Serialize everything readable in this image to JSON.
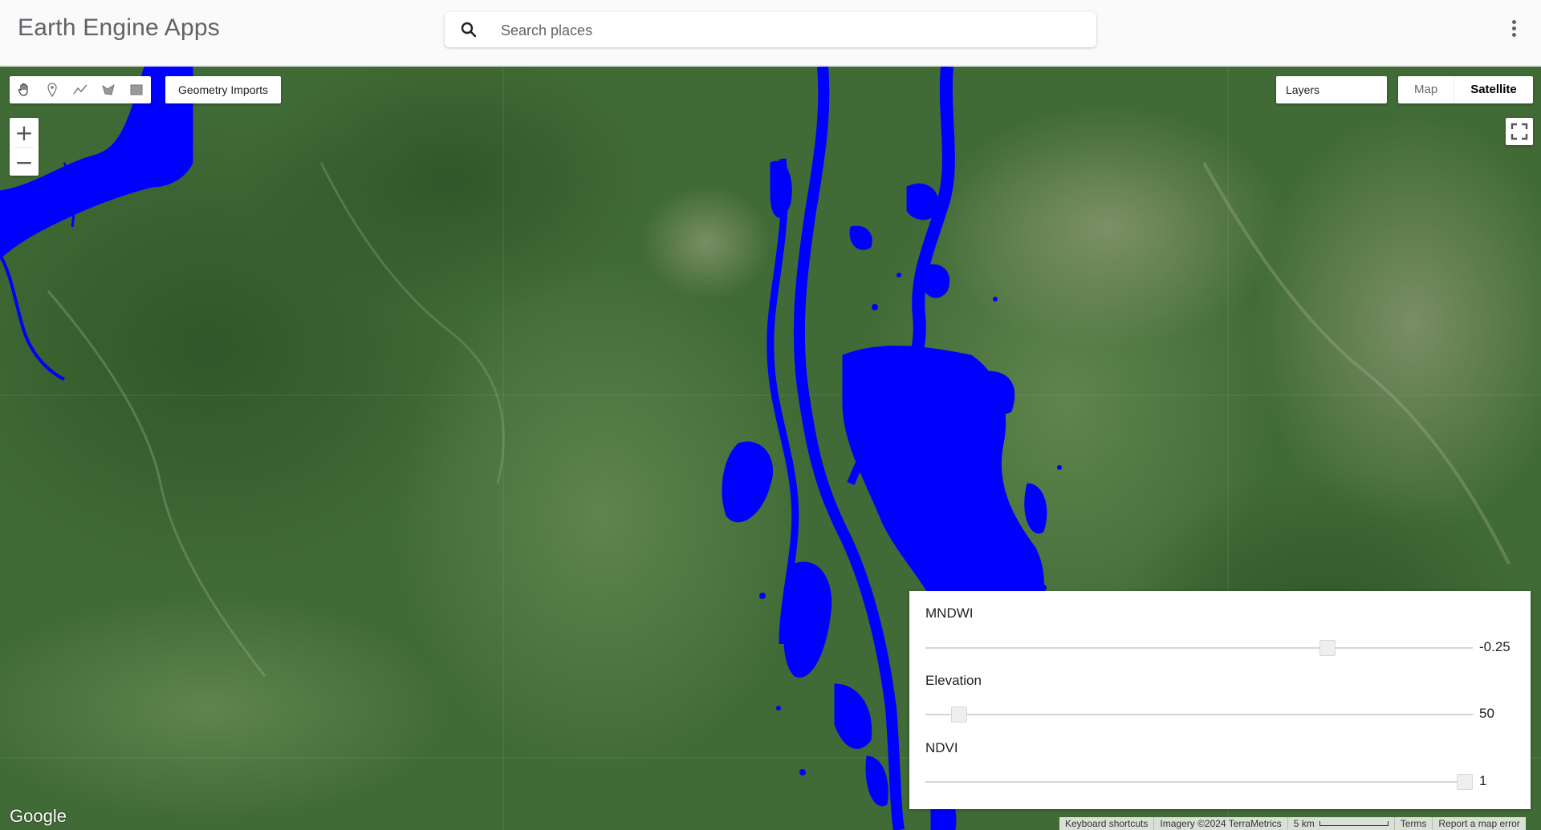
{
  "header": {
    "title": "Earth Engine Apps",
    "search_placeholder": "Search places",
    "search_value": ""
  },
  "map": {
    "geometry_imports_label": "Geometry Imports",
    "layers_label": "Layers",
    "maptype_options": [
      "Map",
      "Satellite"
    ],
    "maptype_selected": "Satellite",
    "google_logo": "Google",
    "attribution": {
      "keyboard_shortcuts": "Keyboard shortcuts",
      "imagery": "Imagery ©2024 TerraMetrics",
      "scale": "5 km",
      "terms": "Terms",
      "report": "Report a map error"
    }
  },
  "sliders": [
    {
      "label": "MNDWI",
      "value": "-0.25",
      "fraction": 0.735
    },
    {
      "label": "Elevation",
      "value": "50",
      "fraction": 0.062
    },
    {
      "label": "NDVI",
      "value": "1",
      "fraction": 0.985
    }
  ],
  "colors": {
    "water_mask": "#0000ff",
    "vegetation": "#3f6a34",
    "header_bg": "#fafafa"
  },
  "icons": {
    "tools": [
      "hand-icon",
      "marker-icon",
      "line-icon",
      "polygon-icon",
      "rectangle-icon"
    ],
    "search": "search-icon",
    "menu": "more-vert-icon",
    "fullscreen": "fullscreen-icon"
  }
}
